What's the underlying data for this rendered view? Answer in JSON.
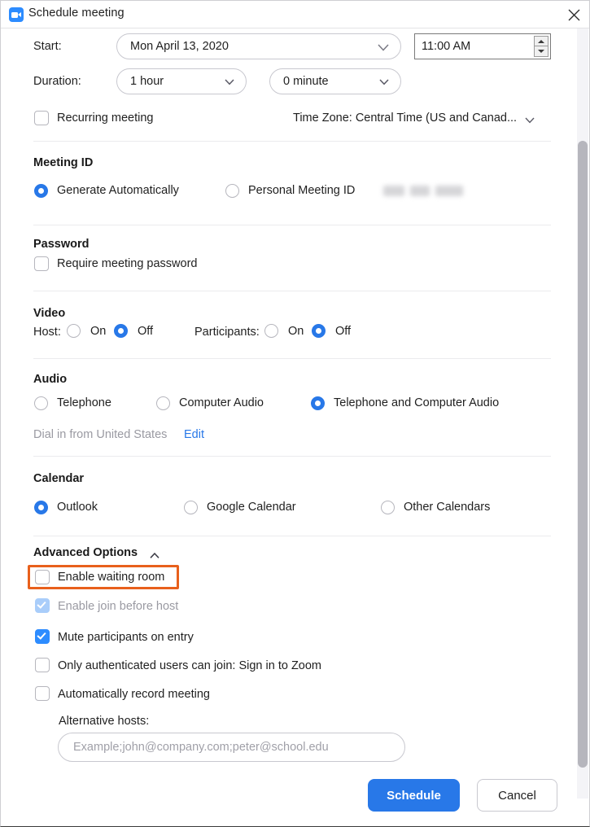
{
  "window": {
    "title": "Schedule meeting",
    "app_icon": "zoom-camera-icon",
    "close_icon": "close-icon"
  },
  "schedule": {
    "start_label": "Start:",
    "start_date": "Mon  April 13, 2020",
    "start_time": "11:00 AM",
    "duration_label": "Duration:",
    "duration_hours": "1 hour",
    "duration_minutes": "0 minute",
    "recurring_label": "Recurring meeting",
    "recurring_checked": false,
    "timezone_label": "Time Zone: Central Time (US and Canad...",
    "timezone_chevron": "chevron-down-icon"
  },
  "meeting_id": {
    "heading": "Meeting ID",
    "options": [
      {
        "label": "Generate Automatically",
        "selected": true
      },
      {
        "label": "Personal Meeting ID",
        "selected": false,
        "value_redacted": true
      }
    ]
  },
  "password": {
    "heading": "Password",
    "require_label": "Require meeting password",
    "require_checked": false
  },
  "video": {
    "heading": "Video",
    "host_label": "Host:",
    "host_on": "On",
    "host_off": "Off",
    "host_selected": "Off",
    "participants_label": "Participants:",
    "participants_on": "On",
    "participants_off": "Off",
    "participants_selected": "Off"
  },
  "audio": {
    "heading": "Audio",
    "options": [
      {
        "label": "Telephone",
        "selected": false
      },
      {
        "label": "Computer Audio",
        "selected": false
      },
      {
        "label": "Telephone and Computer Audio",
        "selected": true
      }
    ],
    "dial_in_text": "Dial in from United States",
    "edit_link": "Edit"
  },
  "calendar": {
    "heading": "Calendar",
    "options": [
      {
        "label": "Outlook",
        "selected": true
      },
      {
        "label": "Google Calendar",
        "selected": false
      },
      {
        "label": "Other Calendars",
        "selected": false
      }
    ]
  },
  "advanced": {
    "heading": "Advanced Options",
    "collapse_icon": "chevron-up-icon",
    "options": [
      {
        "label": "Enable waiting room",
        "checked": false,
        "disabled": false,
        "highlighted": true
      },
      {
        "label": "Enable join before host",
        "checked": true,
        "disabled": true,
        "highlighted": false
      },
      {
        "label": "Mute participants on entry",
        "checked": true,
        "disabled": false,
        "highlighted": false
      },
      {
        "label": "Only authenticated users can join: Sign in to Zoom",
        "checked": false,
        "disabled": false,
        "highlighted": false
      },
      {
        "label": "Automatically record meeting",
        "checked": false,
        "disabled": false,
        "highlighted": false
      }
    ],
    "alt_hosts_label": "Alternative hosts:",
    "alt_hosts_value": "",
    "alt_hosts_placeholder": "Example;john@company.com;peter@school.edu"
  },
  "footer": {
    "schedule_button": "Schedule",
    "cancel_button": "Cancel"
  },
  "colors": {
    "accent_blue": "#2878e8",
    "checkbox_blue": "#2d8cff",
    "disabled_blue": "#a9cdfa",
    "highlight_orange": "#e8601c",
    "link_blue": "#2878e8"
  }
}
